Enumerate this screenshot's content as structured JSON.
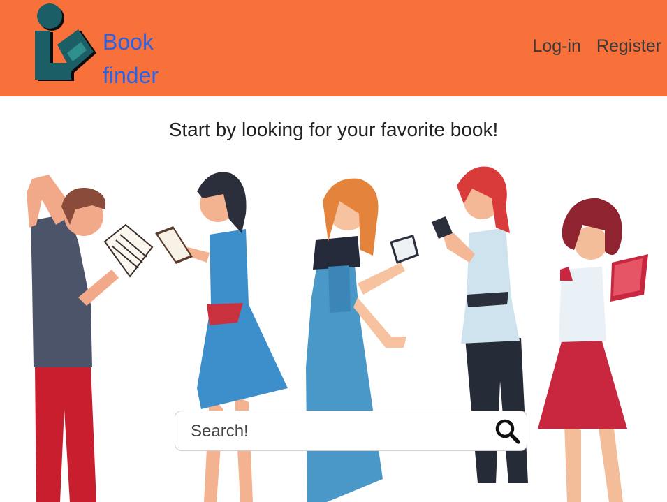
{
  "header": {
    "brand_line1": "Book",
    "brand_line2": "finder",
    "nav": {
      "login": "Log-in",
      "register": "Register"
    }
  },
  "main": {
    "tagline": "Start by looking for your favorite book!"
  },
  "search": {
    "placeholder": "Search!",
    "icon": "search-icon"
  },
  "colors": {
    "header_bg": "#f8703a",
    "brand_text": "#2563eb",
    "logo_teal": "#1b5e66"
  }
}
